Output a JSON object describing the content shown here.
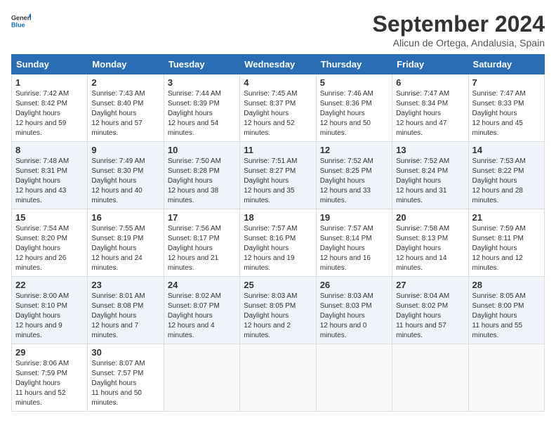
{
  "header": {
    "logo_general": "General",
    "logo_blue": "Blue",
    "month_title": "September 2024",
    "location": "Alicun de Ortega, Andalusia, Spain"
  },
  "weekdays": [
    "Sunday",
    "Monday",
    "Tuesday",
    "Wednesday",
    "Thursday",
    "Friday",
    "Saturday"
  ],
  "weeks": [
    {
      "shade": "white",
      "days": [
        {
          "num": "1",
          "sunrise": "7:42 AM",
          "sunset": "8:42 PM",
          "daylight": "12 hours and 59 minutes."
        },
        {
          "num": "2",
          "sunrise": "7:43 AM",
          "sunset": "8:40 PM",
          "daylight": "12 hours and 57 minutes."
        },
        {
          "num": "3",
          "sunrise": "7:44 AM",
          "sunset": "8:39 PM",
          "daylight": "12 hours and 54 minutes."
        },
        {
          "num": "4",
          "sunrise": "7:45 AM",
          "sunset": "8:37 PM",
          "daylight": "12 hours and 52 minutes."
        },
        {
          "num": "5",
          "sunrise": "7:46 AM",
          "sunset": "8:36 PM",
          "daylight": "12 hours and 50 minutes."
        },
        {
          "num": "6",
          "sunrise": "7:47 AM",
          "sunset": "8:34 PM",
          "daylight": "12 hours and 47 minutes."
        },
        {
          "num": "7",
          "sunrise": "7:47 AM",
          "sunset": "8:33 PM",
          "daylight": "12 hours and 45 minutes."
        }
      ]
    },
    {
      "shade": "shade",
      "days": [
        {
          "num": "8",
          "sunrise": "7:48 AM",
          "sunset": "8:31 PM",
          "daylight": "12 hours and 43 minutes."
        },
        {
          "num": "9",
          "sunrise": "7:49 AM",
          "sunset": "8:30 PM",
          "daylight": "12 hours and 40 minutes."
        },
        {
          "num": "10",
          "sunrise": "7:50 AM",
          "sunset": "8:28 PM",
          "daylight": "12 hours and 38 minutes."
        },
        {
          "num": "11",
          "sunrise": "7:51 AM",
          "sunset": "8:27 PM",
          "daylight": "12 hours and 35 minutes."
        },
        {
          "num": "12",
          "sunrise": "7:52 AM",
          "sunset": "8:25 PM",
          "daylight": "12 hours and 33 minutes."
        },
        {
          "num": "13",
          "sunrise": "7:52 AM",
          "sunset": "8:24 PM",
          "daylight": "12 hours and 31 minutes."
        },
        {
          "num": "14",
          "sunrise": "7:53 AM",
          "sunset": "8:22 PM",
          "daylight": "12 hours and 28 minutes."
        }
      ]
    },
    {
      "shade": "white",
      "days": [
        {
          "num": "15",
          "sunrise": "7:54 AM",
          "sunset": "8:20 PM",
          "daylight": "12 hours and 26 minutes."
        },
        {
          "num": "16",
          "sunrise": "7:55 AM",
          "sunset": "8:19 PM",
          "daylight": "12 hours and 24 minutes."
        },
        {
          "num": "17",
          "sunrise": "7:56 AM",
          "sunset": "8:17 PM",
          "daylight": "12 hours and 21 minutes."
        },
        {
          "num": "18",
          "sunrise": "7:57 AM",
          "sunset": "8:16 PM",
          "daylight": "12 hours and 19 minutes."
        },
        {
          "num": "19",
          "sunrise": "7:57 AM",
          "sunset": "8:14 PM",
          "daylight": "12 hours and 16 minutes."
        },
        {
          "num": "20",
          "sunrise": "7:58 AM",
          "sunset": "8:13 PM",
          "daylight": "12 hours and 14 minutes."
        },
        {
          "num": "21",
          "sunrise": "7:59 AM",
          "sunset": "8:11 PM",
          "daylight": "12 hours and 12 minutes."
        }
      ]
    },
    {
      "shade": "shade",
      "days": [
        {
          "num": "22",
          "sunrise": "8:00 AM",
          "sunset": "8:10 PM",
          "daylight": "12 hours and 9 minutes."
        },
        {
          "num": "23",
          "sunrise": "8:01 AM",
          "sunset": "8:08 PM",
          "daylight": "12 hours and 7 minutes."
        },
        {
          "num": "24",
          "sunrise": "8:02 AM",
          "sunset": "8:07 PM",
          "daylight": "12 hours and 4 minutes."
        },
        {
          "num": "25",
          "sunrise": "8:03 AM",
          "sunset": "8:05 PM",
          "daylight": "12 hours and 2 minutes."
        },
        {
          "num": "26",
          "sunrise": "8:03 AM",
          "sunset": "8:03 PM",
          "daylight": "12 hours and 0 minutes."
        },
        {
          "num": "27",
          "sunrise": "8:04 AM",
          "sunset": "8:02 PM",
          "daylight": "11 hours and 57 minutes."
        },
        {
          "num": "28",
          "sunrise": "8:05 AM",
          "sunset": "8:00 PM",
          "daylight": "11 hours and 55 minutes."
        }
      ]
    },
    {
      "shade": "white",
      "days": [
        {
          "num": "29",
          "sunrise": "8:06 AM",
          "sunset": "7:59 PM",
          "daylight": "11 hours and 52 minutes."
        },
        {
          "num": "30",
          "sunrise": "8:07 AM",
          "sunset": "7:57 PM",
          "daylight": "11 hours and 50 minutes."
        },
        null,
        null,
        null,
        null,
        null
      ]
    }
  ]
}
